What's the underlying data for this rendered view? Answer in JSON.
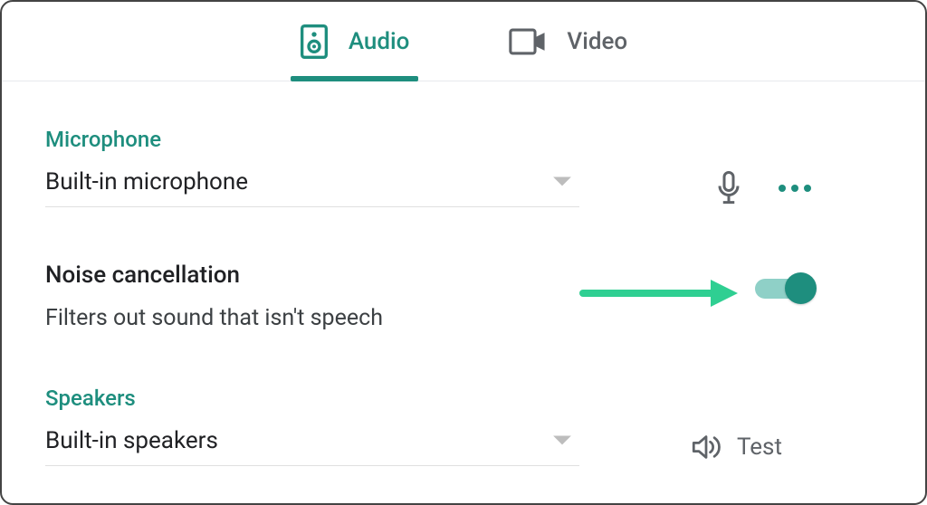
{
  "tabs": {
    "audio": "Audio",
    "video": "Video"
  },
  "microphone": {
    "label": "Microphone",
    "selected": "Built-in microphone"
  },
  "noise_cancellation": {
    "title": "Noise cancellation",
    "description": "Filters out sound that isn't speech",
    "enabled": true
  },
  "speakers": {
    "label": "Speakers",
    "selected": "Built-in speakers",
    "test_label": "Test"
  },
  "colors": {
    "accent": "#1e8e7e",
    "arrow": "#2fcf92"
  }
}
